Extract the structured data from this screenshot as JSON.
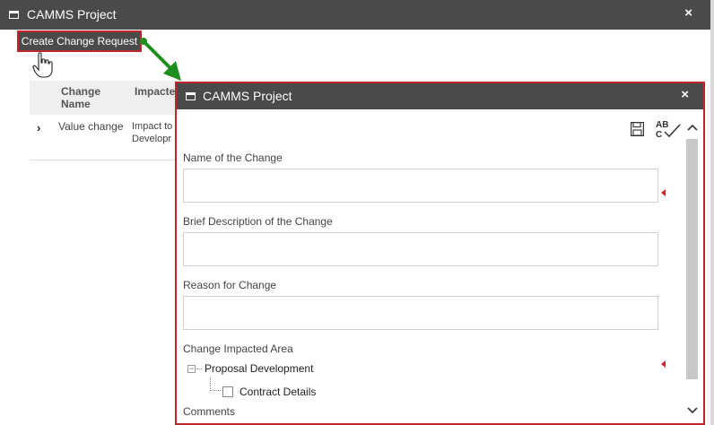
{
  "background_window": {
    "title": "CAMMS Project",
    "close_glyph": "×",
    "create_button_label": "Create Change Request",
    "table": {
      "headers": [
        "Change Name",
        "Impacte"
      ],
      "rows": [
        {
          "expand_glyph": "›",
          "change_name": "Value change",
          "impact": "Impact to Developr"
        }
      ]
    }
  },
  "dialog": {
    "title": "CAMMS Project",
    "close_glyph": "×",
    "toolbar": {
      "save_icon": "save-icon",
      "spellcheck_icon": "spellcheck-icon",
      "spellcheck_text": "AB C"
    },
    "fields": [
      {
        "label": "Name of the Change",
        "value": "",
        "required": true
      },
      {
        "label": "Brief Description of the Change",
        "value": "",
        "required": false
      },
      {
        "label": "Reason for Change",
        "value": "",
        "required": false
      }
    ],
    "impacted_area": {
      "label": "Change Impacted Area",
      "tree": {
        "expander": "−",
        "node": "Proposal Development",
        "children": [
          {
            "label": "Contract Details",
            "checked": false
          }
        ]
      },
      "required": true
    },
    "comments_label": "Comments"
  },
  "colors": {
    "titlebar": "#4a4a4a",
    "highlight_border": "#c0272d",
    "required_marker": "#d9232a",
    "callout_arrow": "#1f8f1f"
  }
}
